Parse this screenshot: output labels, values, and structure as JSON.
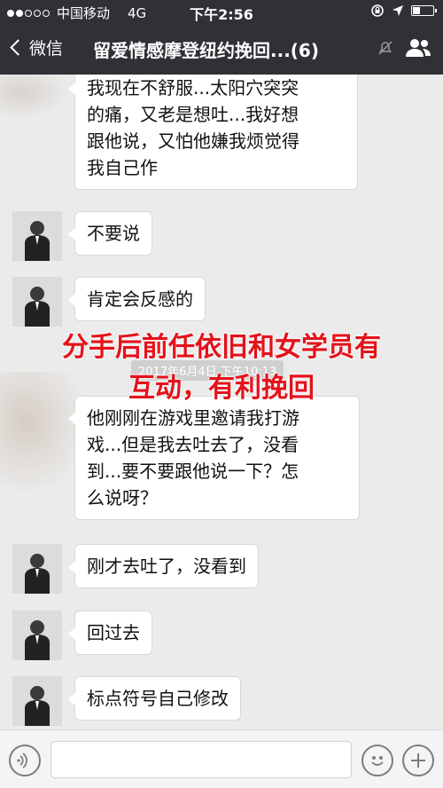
{
  "status_bar": {
    "carrier": "中国移动",
    "network": "4G",
    "time": "下午2:56"
  },
  "nav": {
    "back_label": "微信",
    "title": "留爱情感摩登纽约挽回...(6)",
    "icons": [
      "mute-icon",
      "group-members-icon"
    ]
  },
  "chat": {
    "timestamp": "2017年6月4日 下午10:13",
    "overlay_lines": [
      "分手后前任依旧和女学员有",
      "互动，有利挽回"
    ],
    "messages": [
      {
        "lines": [
          "我现在不舒服...太阳穴突突",
          "的痛，又老是想吐...我好想",
          "跟他说，又怕他嫌我烦觉得",
          "我自己作"
        ]
      },
      {
        "lines": [
          "不要说"
        ]
      },
      {
        "lines": [
          "肯定会反感的"
        ]
      },
      {
        "lines": [
          "他刚刚在游戏里邀请我打游",
          "戏...但是我去吐去了，没看",
          "到...要不要跟他说一下？怎",
          "么说呀？"
        ]
      },
      {
        "lines": [
          "刚才去吐了，没看到"
        ]
      },
      {
        "lines": [
          "回过去"
        ]
      },
      {
        "lines": [
          "标点符号自己修改"
        ]
      }
    ]
  },
  "input_bar": {
    "icons": [
      "voice-icon",
      "emoji-icon",
      "plus-icon"
    ]
  },
  "colors": {
    "status_bar_bg": "#2f3136",
    "chat_bg": "#ebebeb",
    "overlay_text": "#e4121b"
  }
}
